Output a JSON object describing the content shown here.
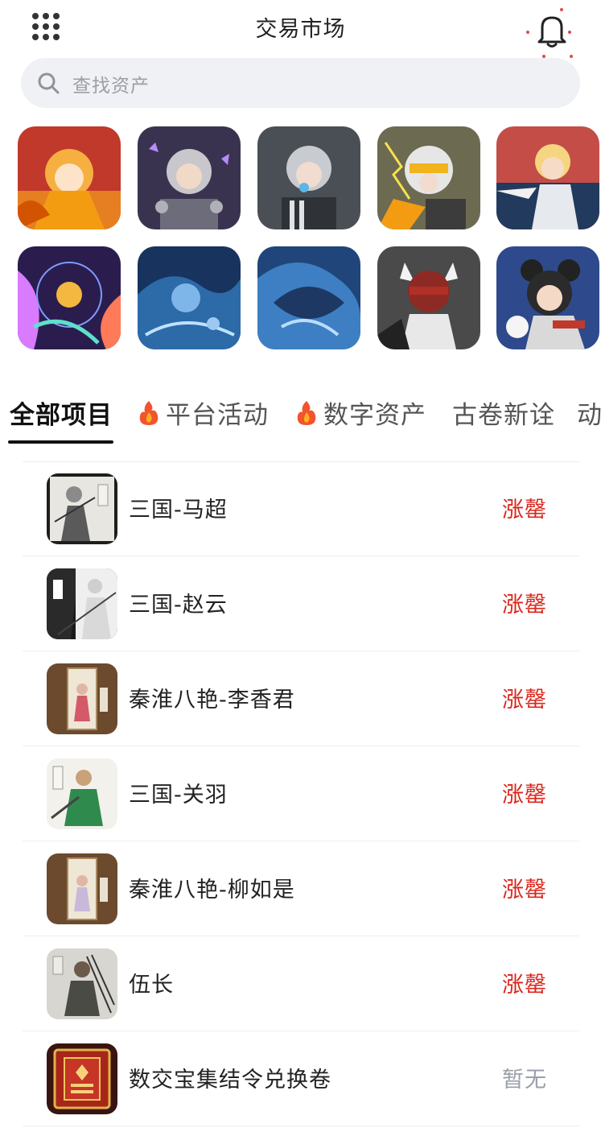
{
  "header": {
    "title": "交易市场",
    "menu_icon": "grid-menu-icon",
    "notification_icon": "bell-icon"
  },
  "search": {
    "placeholder": "查找资产",
    "icon": "search-icon"
  },
  "tabs": [
    {
      "label": "全部项目",
      "active": true
    },
    {
      "label": "平台活动",
      "icon": "fire-icon",
      "active": false
    },
    {
      "label": "数字资产",
      "icon": "fire-icon",
      "active": false
    },
    {
      "label": "古卷新诠",
      "active": false
    },
    {
      "label": "动",
      "active": false
    }
  ],
  "items": [
    {
      "name": "三国-马超",
      "status": "涨罄"
    },
    {
      "name": "三国-赵云",
      "status": "涨罄"
    },
    {
      "name": "秦淮八艳-李香君",
      "status": "涨罄"
    },
    {
      "name": "三国-关羽",
      "status": "涨罄"
    },
    {
      "name": "秦淮八艳-柳如是",
      "status": "涨罄"
    },
    {
      "name": "伍长",
      "status": "涨罄"
    },
    {
      "name": "数交宝集结令兑换卷",
      "status": "暂无"
    }
  ],
  "colors": {
    "status_active": "#d9261c",
    "status_inactive": "#9a9ea7",
    "search_bg": "#f0f1f4"
  }
}
